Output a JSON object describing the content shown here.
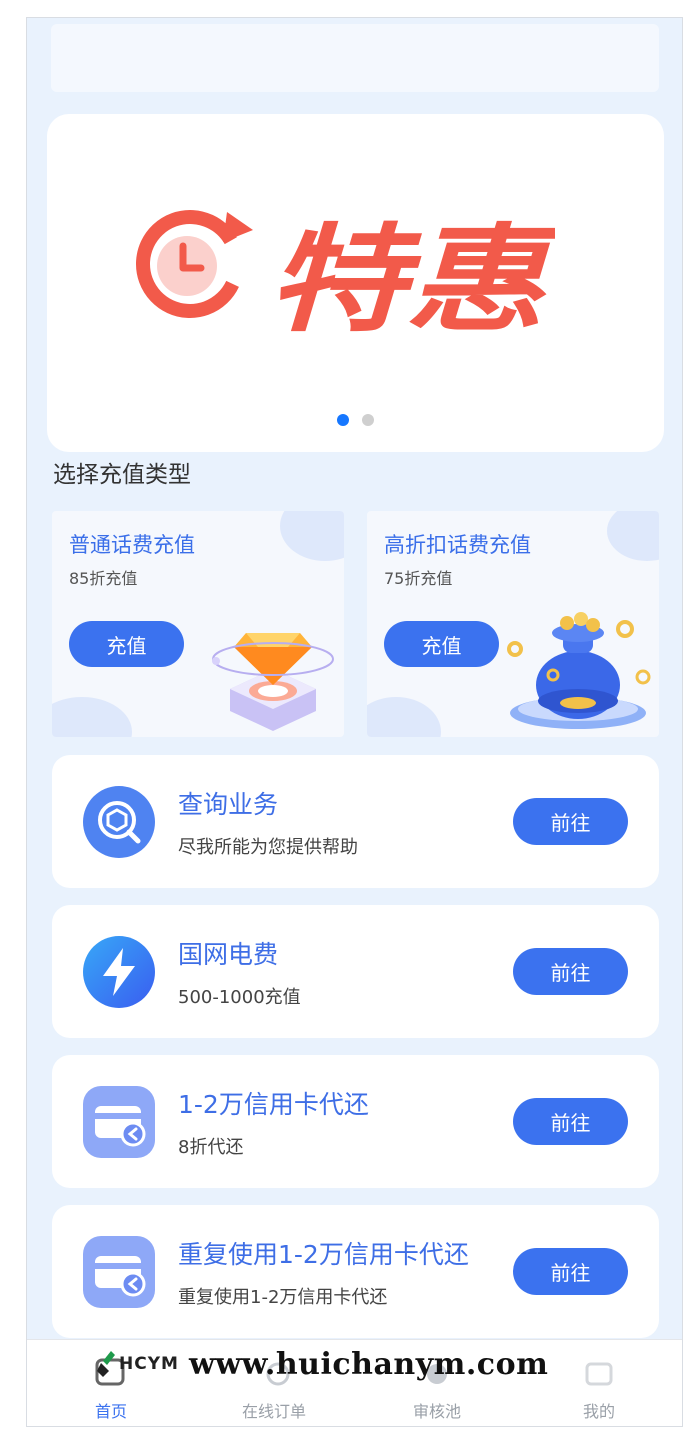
{
  "banner": {
    "text": "特惠",
    "dots": 2,
    "active_dot": 0,
    "accent": "#f25a4a"
  },
  "section_title": "选择充值类型",
  "types": [
    {
      "title": "普通话费充值",
      "subtitle": "85折充值",
      "button": "充值",
      "decor": "diamond-illustration"
    },
    {
      "title": "高折扣话费充值",
      "subtitle": "75折充值",
      "button": "充值",
      "decor": "coin-bag-illustration"
    }
  ],
  "services": [
    {
      "title": "查询业务",
      "subtitle": "尽我所能为您提供帮助",
      "button": "前往",
      "icon": "search-cube-icon"
    },
    {
      "title": "国网电费",
      "subtitle": "500-1000充值",
      "button": "前往",
      "icon": "lightning-icon"
    },
    {
      "title": "1-2万信用卡代还",
      "subtitle": "8折代还",
      "button": "前往",
      "icon": "credit-card-icon"
    },
    {
      "title": "重复使用1-2万信用卡代还",
      "subtitle": "重复使用1-2万信用卡代还",
      "button": "前往",
      "icon": "credit-card-icon"
    }
  ],
  "tabs": [
    {
      "label": "首页",
      "icon": "home-icon",
      "active": true
    },
    {
      "label": "在线订单",
      "icon": "order-icon",
      "active": false
    },
    {
      "label": "审核池",
      "icon": "review-icon",
      "active": false
    },
    {
      "label": "我的",
      "icon": "profile-icon",
      "active": false
    }
  ],
  "watermark": {
    "logo": "HCYM",
    "url": "www.huichanym.com"
  },
  "colors": {
    "primary": "#3b72ef",
    "background": "#e9f2fd",
    "title_blue": "#3e6ee6"
  }
}
